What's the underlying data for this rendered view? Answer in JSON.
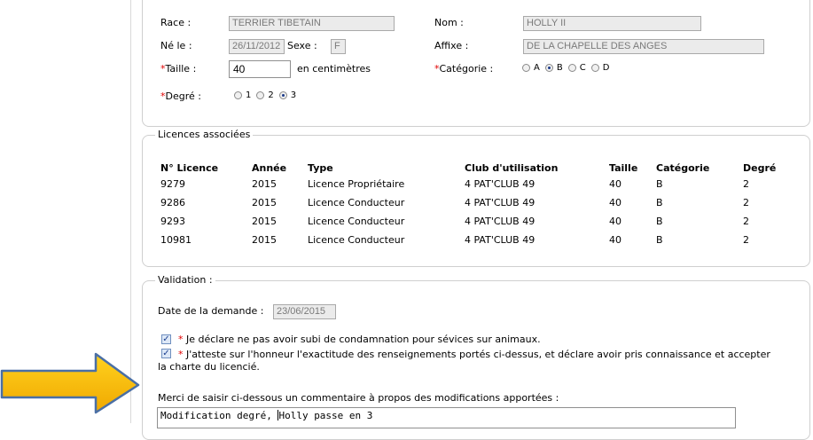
{
  "dog": {
    "race_label": "Race :",
    "race": "TERRIER TIBETAIN",
    "nom_label": "Nom :",
    "nom": "HOLLY II",
    "ne_label": "Né le :",
    "ne_le": "26/11/2012",
    "sexe_label": "Sexe :",
    "sexe": "F",
    "affixe_label": "Affixe :",
    "affixe": "DE LA CHAPELLE DES ANGES",
    "taille_label": "Taille :",
    "taille": "40",
    "taille_unit": "en centimètres",
    "categorie_label": "Catégorie :",
    "categories": [
      "A",
      "B",
      "C",
      "D"
    ],
    "categorie_selected": "B",
    "degre_label": "Degré :",
    "degres": [
      "1",
      "2",
      "3"
    ],
    "degre_selected": "3",
    "required_mark": "*"
  },
  "licences": {
    "legend": "Licences associées",
    "headers": [
      "N° Licence",
      "Année",
      "Type",
      "Club d'utilisation",
      "Taille",
      "Catégorie",
      "Degré"
    ],
    "rows": [
      [
        "9279",
        "2015",
        "Licence Propriétaire",
        "4 PAT'CLUB 49",
        "40",
        "B",
        "2"
      ],
      [
        "9286",
        "2015",
        "Licence Conducteur",
        "4 PAT'CLUB 49",
        "40",
        "B",
        "2"
      ],
      [
        "9293",
        "2015",
        "Licence Conducteur",
        "4 PAT'CLUB 49",
        "40",
        "B",
        "2"
      ],
      [
        "10981",
        "2015",
        "Licence Conducteur",
        "4 PAT'CLUB 49",
        "40",
        "B",
        "2"
      ]
    ]
  },
  "validation": {
    "legend": "Validation :",
    "date_label": "Date de la demande :",
    "date": "23/06/2015",
    "check1": "Je déclare ne pas avoir subi de condamnation pour sévices sur animaux.",
    "check2_line1": "J'atteste sur l'honneur l'exactitude des renseignements portés ci-dessus, et déclare avoir pris connaissance et accepter",
    "check2_line2": "la charte du licencié.",
    "comment_label": "Merci de saisir ci-dessous un commentaire à propos des modifications apportées :",
    "comment_before_caret": "Modification degré, ",
    "comment_after_caret": "Holly passe en 3"
  },
  "colors": {
    "arrow_fill": "#f5b800",
    "arrow_stroke": "#4a6fa5",
    "required": "#e00000"
  }
}
